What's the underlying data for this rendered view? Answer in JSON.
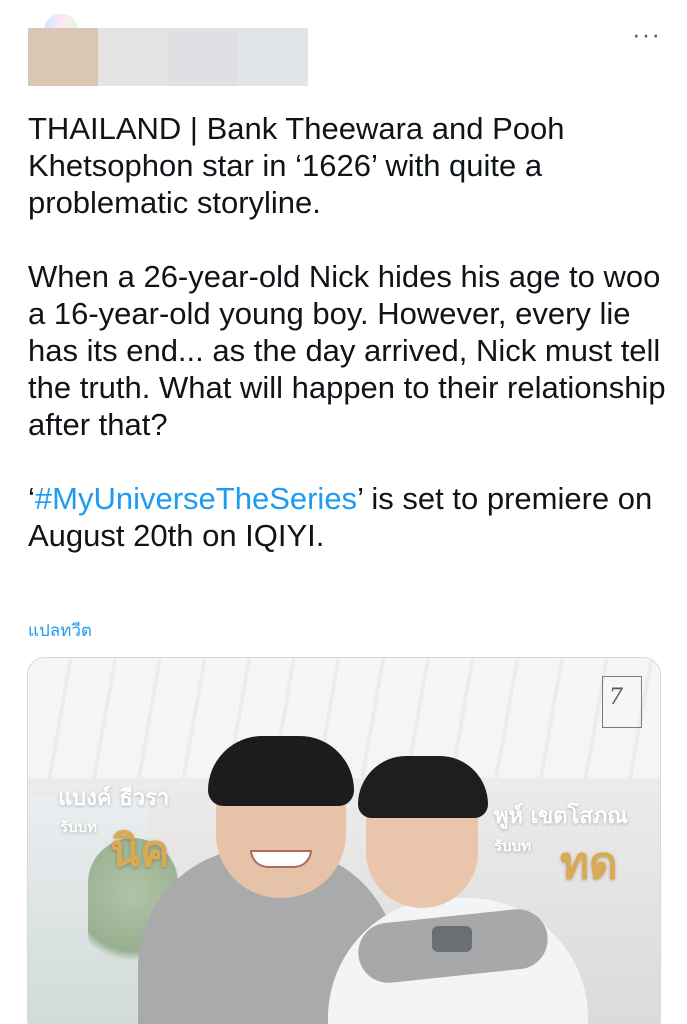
{
  "header": {
    "more_label": "···"
  },
  "tweet": {
    "paragraph1": "THAILAND | Bank Theewara and Pooh Khetsophon star in ‘1626’ with quite a problematic storyline.",
    "paragraph2": "When a 26-year-old Nick hides his age to woo a 16-year-old young boy. However, every lie has its end... as the day arrived, Nick must tell the truth. What will happen to their relationship after that?",
    "paragraph3_prefix": "‘",
    "hashtag": "#MyUniverseTheSeries",
    "paragraph3_suffix": "’ is set to premiere on August 20th on IQIYI.",
    "translate_label": "แปลทวีต"
  },
  "media": {
    "left_name": "แบงค์ ธีวรา",
    "left_role": "รับบท",
    "left_character": "นิค",
    "right_name": "พูห์ เขตโสภณ",
    "right_role": "รับบท",
    "right_character": "ทด",
    "logo_mark": "7"
  },
  "colors": {
    "text": "#0f1419",
    "link": "#1d9bf0",
    "secondary": "#536471",
    "accent_gold": "#d9a954"
  }
}
